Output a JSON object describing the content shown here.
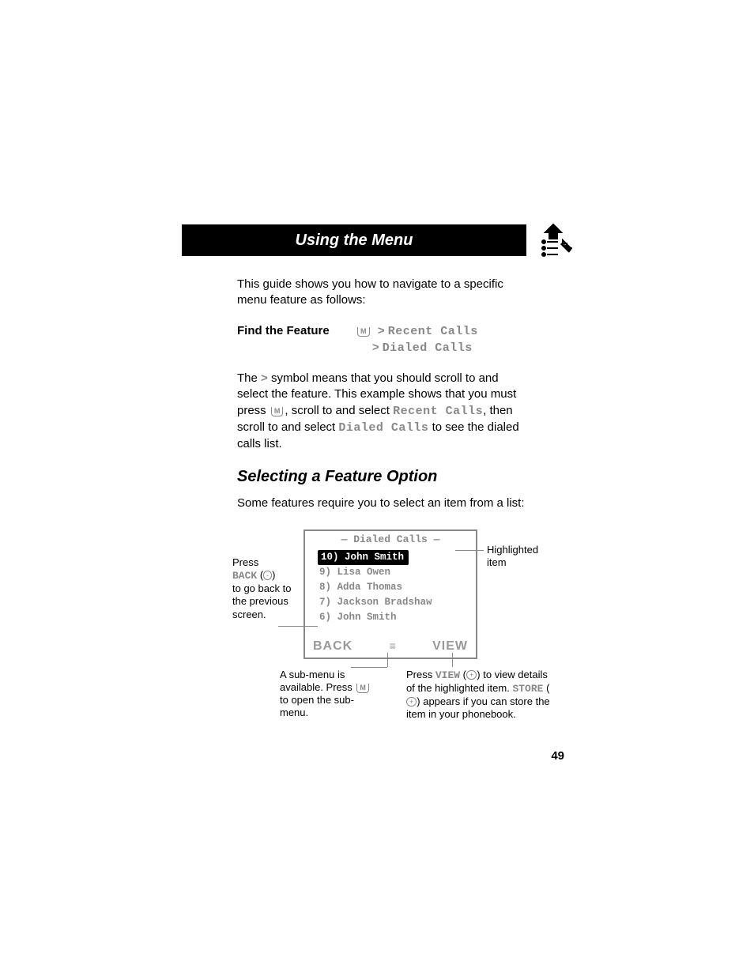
{
  "title": "Using the Menu",
  "intro": "This guide shows you how to navigate to a specific menu feature as follows:",
  "find_label": "Find the Feature",
  "menu_key": "M",
  "gt": ">",
  "recent_calls": "Recent Calls",
  "dialed_calls": "Dialed Calls",
  "explain_1": "The ",
  "explain_2": " symbol means that you should scroll to and select the feature. This example shows that you must press ",
  "explain_3": ", scroll to and select ",
  "explain_4": ", then scroll to and select ",
  "explain_5": " to see the dialed calls list.",
  "heading2": "Selecting a Feature Option",
  "some_features": "Some features require you to select an item from a list:",
  "screen_title": "Dialed Calls",
  "list": [
    "10) John Smith",
    "9) Lisa Owen",
    "8) Adda Thomas",
    "7) Jackson Bradshaw",
    "6) John Smith"
  ],
  "softkey_left": "BACK",
  "softkey_center": "≡",
  "softkey_right": "VIEW",
  "callout_left_1": "Press",
  "callout_left_back": "BACK",
  "callout_left_bubble": "-",
  "callout_left_2": "to go back to the previous screen.",
  "callout_right_top": "Highlighted item",
  "callout_bl_1": "A sub-menu is available. Press ",
  "callout_bl_2": " to open the sub-menu.",
  "callout_br_1": "Press ",
  "callout_br_view": "VIEW",
  "callout_br_bubble": "+",
  "callout_br_2": " to view details of the highlighted item.",
  "callout_br_3": "STORE",
  "callout_br_4": " appears if you can store the item in your phonebook.",
  "page_num": "49"
}
